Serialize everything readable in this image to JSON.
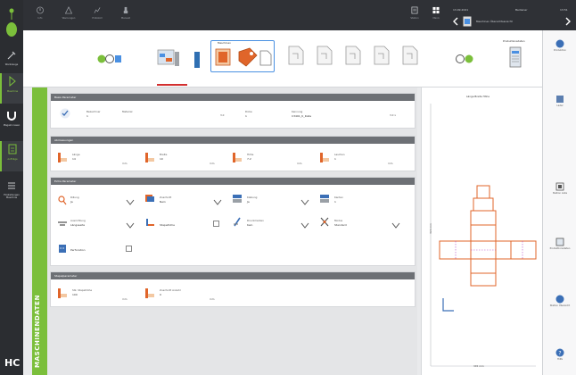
{
  "topbar": {
    "date": "13.09.2021",
    "user_label": "Bediener",
    "time": "13:51",
    "status_text": "Maschinen Übersichtsansicht",
    "icons": [
      {
        "name": "info-icon",
        "label": "Info"
      },
      {
        "name": "warning-icon",
        "label": "Warnungen"
      },
      {
        "name": "log-icon",
        "label": "Protokoll"
      },
      {
        "name": "hand-icon",
        "label": "Manuell"
      }
    ],
    "right_icons": [
      {
        "name": "station-icon",
        "label": "Station"
      },
      {
        "name": "grid-icon",
        "label": "Menü"
      }
    ]
  },
  "left_sidebar": {
    "items": [
      {
        "name": "sidebar-item-tools",
        "label": "Werkzeuge"
      },
      {
        "name": "sidebar-item-machine",
        "label": "Maschine"
      },
      {
        "name": "sidebar-item-magnet",
        "label": "Magazin lesen"
      },
      {
        "name": "sidebar-item-jobs",
        "label": "Aufträge"
      },
      {
        "name": "sidebar-item-settings",
        "label": "Einstellungen Maschine"
      }
    ],
    "brand": "HC"
  },
  "steps": {
    "tooltip": "Maschinen",
    "right_label": "Produktionsdaten"
  },
  "main": {
    "vertical_label": "MASCHINENDATEN",
    "section_basic": {
      "title": "Basis Parameter",
      "field1_label": "Bezeichner",
      "field1_value": "1",
      "field2_label": "Material",
      "field3_label": "Dicke",
      "field3_value": "3.0",
      "field4_value": "1",
      "field5_label": "Kennung",
      "field5_value": "C3491_K_Kiste",
      "field6_value": "3.0 x"
    },
    "section_dimensions": {
      "title": "Abmessungen",
      "fields": [
        {
          "label": "Länge",
          "value": "14",
          "unit": "mm"
        },
        {
          "label": "Breite",
          "value": "10",
          "unit": "mm"
        },
        {
          "label": "Höhe",
          "value": "7.2",
          "unit": "mm"
        },
        {
          "label": "Laschen",
          "value": "1",
          "unit": "mm"
        }
      ]
    },
    "section_extra": {
      "title": "Extra Parameter",
      "row1": [
        {
          "label": "Rillung",
          "value": "Ja"
        },
        {
          "label": "Zuschnitt",
          "value": "Nein"
        },
        {
          "label": "Klebung",
          "value": "Ja"
        },
        {
          "label": "Kanten",
          "value": "1"
        }
      ],
      "row2": [
        {
          "label": "Ausrichtung",
          "value": "Längsseite"
        },
        {
          "label": "",
          "value": "Stapelhöhe"
        },
        {
          "label": "Druckmarken",
          "value": "Kein"
        },
        {
          "label": "Modus",
          "value": "Standard"
        }
      ],
      "row3_value": "Perforation"
    },
    "section_stack": {
      "title": "Stapelparameter",
      "fields": [
        {
          "label": "Stk. Stapelhöhe",
          "value": "100",
          "unit": "mm"
        },
        {
          "label": "Zuschnitt Anzahl",
          "value": "0",
          "unit": "mm"
        }
      ]
    }
  },
  "diagram": {
    "header": "Länge   Breite   Höhe",
    "dim_x": "345 mm",
    "dim_y": "320 mm"
  },
  "right_sidebar": {
    "items": [
      {
        "name": "right-item-1",
        "label": "Produktion"
      },
      {
        "name": "right-item-2",
        "label": "Lader"
      },
      {
        "name": "right-item-3",
        "label": "Station Liste"
      },
      {
        "name": "right-item-4",
        "label": "Produktionsdaten"
      },
      {
        "name": "right-item-5",
        "label": "Station Übersicht"
      },
      {
        "name": "right-item-6",
        "label": "Hilfe"
      }
    ]
  },
  "colors": {
    "accent_green": "#7bbf3b",
    "accent_orange": "#e0652a",
    "accent_blue": "#4a90e2",
    "dark": "#2b2d31"
  }
}
